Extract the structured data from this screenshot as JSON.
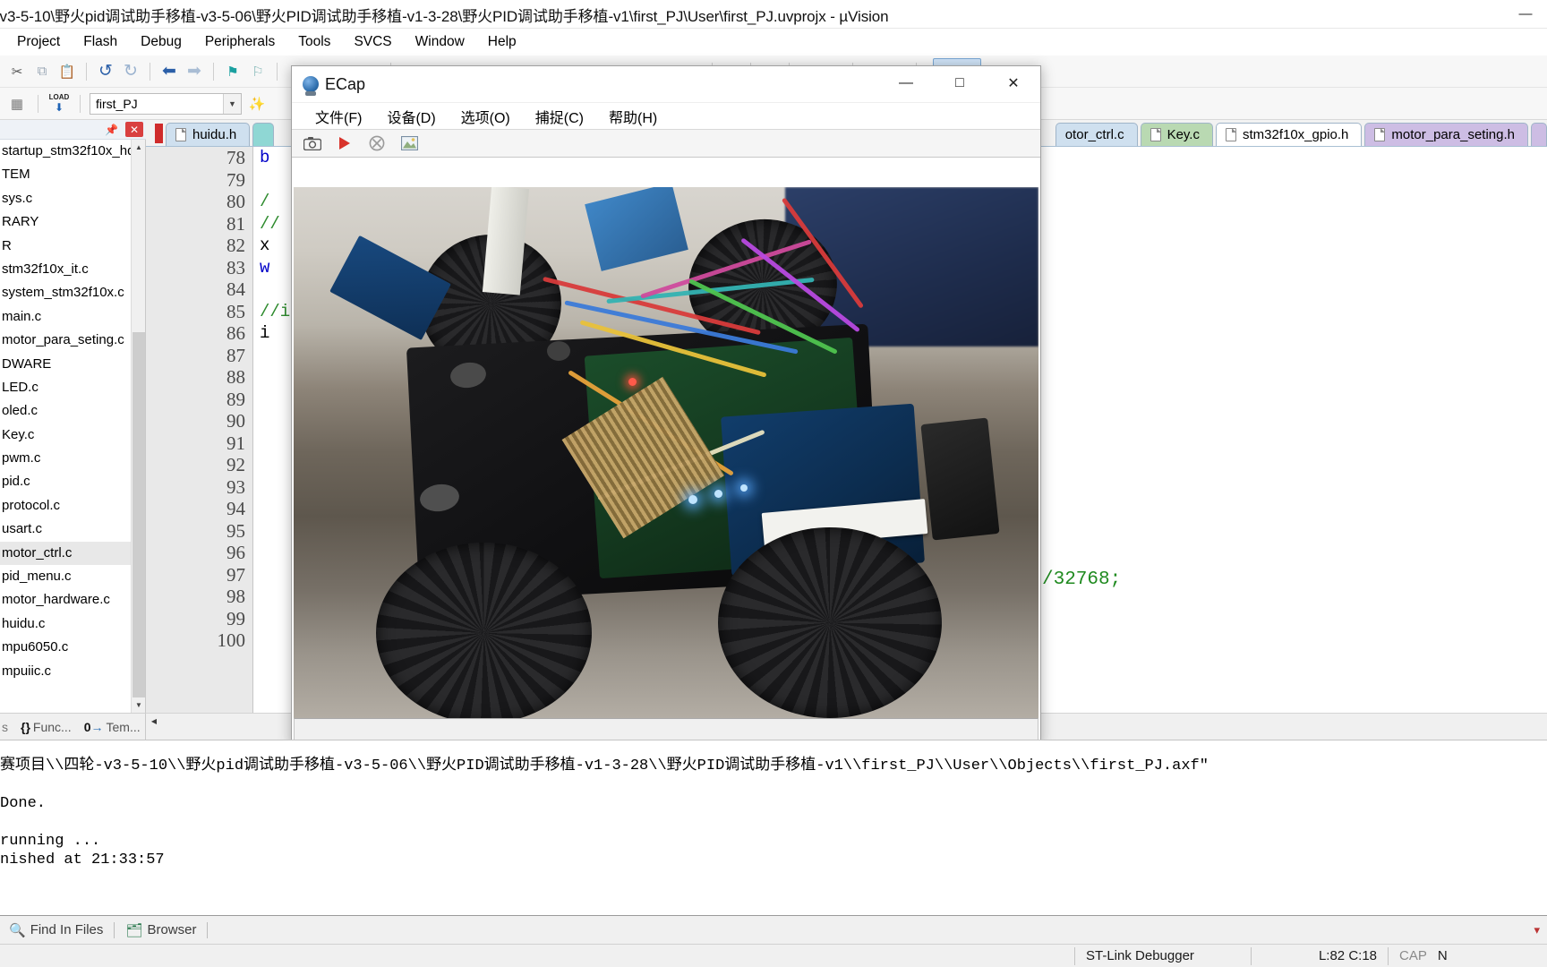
{
  "window": {
    "title": "-v3-5-10\\野火pid调试助手移植-v3-5-06\\野火PID调试助手移植-v1-3-28\\野火PID调试助手移植-v1\\first_PJ\\User\\first_PJ.uvprojx - µVision",
    "minimize": "—",
    "maximize": "▫",
    "close": "✕"
  },
  "menubar": {
    "items": [
      {
        "label": "Project"
      },
      {
        "label": "Flash"
      },
      {
        "label": "Debug"
      },
      {
        "label": "Peripherals"
      },
      {
        "label": "Tools"
      },
      {
        "label": "SVCS"
      },
      {
        "label": "Window"
      },
      {
        "label": "Help"
      }
    ]
  },
  "toolbar": {
    "row1_icons": [
      "cut-icon",
      "copy-icon",
      "paste-icon",
      "undo-icon",
      "redo-icon",
      "navigate-back-icon",
      "navigate-forward-icon",
      "bookmark-icon",
      "bookmark-next-icon"
    ],
    "row2": {
      "target_icon": "build-target-icon",
      "load_icon": "load-icon",
      "load_label": "LOAD",
      "project_value": "first_PJ",
      "dropdown_caret": "▼",
      "magic_wand_icon": "options-for-target-icon"
    }
  },
  "sidebar": {
    "pin_icon": "pin-icon",
    "close_icon": "✕",
    "items": [
      {
        "label": "startup_stm32f10x_hd",
        "selected": false
      },
      {
        "label": "TEM",
        "selected": false
      },
      {
        "label": "sys.c",
        "selected": false
      },
      {
        "label": "RARY",
        "selected": false
      },
      {
        "label": "R",
        "selected": false
      },
      {
        "label": "stm32f10x_it.c",
        "selected": false
      },
      {
        "label": "system_stm32f10x.c",
        "selected": false
      },
      {
        "label": "main.c",
        "selected": false
      },
      {
        "label": "motor_para_seting.c",
        "selected": false
      },
      {
        "label": "DWARE",
        "selected": false
      },
      {
        "label": "LED.c",
        "selected": false
      },
      {
        "label": "oled.c",
        "selected": false
      },
      {
        "label": "Key.c",
        "selected": false
      },
      {
        "label": "pwm.c",
        "selected": false
      },
      {
        "label": "pid.c",
        "selected": false
      },
      {
        "label": "protocol.c",
        "selected": false
      },
      {
        "label": "usart.c",
        "selected": false
      },
      {
        "label": "motor_ctrl.c",
        "selected": true
      },
      {
        "label": "pid_menu.c",
        "selected": false
      },
      {
        "label": "motor_hardware.c",
        "selected": false
      },
      {
        "label": "huidu.c",
        "selected": false
      },
      {
        "label": "mpu6050.c",
        "selected": false
      },
      {
        "label": "mpuiic.c",
        "selected": false
      }
    ],
    "footer": {
      "tabs": [
        "Func...",
        "Tem..."
      ],
      "func_icon": "{}",
      "tem_icon": "0→"
    }
  },
  "editor": {
    "tabs": [
      {
        "label": "huidu.h",
        "color": "#cfe0ef",
        "active": true
      },
      {
        "label": "otor_ctrl.c",
        "color": "#cfe0ef",
        "active": false
      },
      {
        "label": "Key.c",
        "color": "#b9d9b2",
        "active": false
      },
      {
        "label": "stm32f10x_gpio.h",
        "color": "#ffffff",
        "active": false
      },
      {
        "label": "motor_para_seting.h",
        "color": "#cdbde4",
        "active": false
      }
    ],
    "line_numbers": [
      78,
      79,
      80,
      81,
      82,
      83,
      84,
      85,
      86,
      87,
      88,
      89,
      90,
      91,
      92,
      93,
      94,
      95,
      96,
      97,
      98,
      99,
      100
    ],
    "visible_code_left": [
      "b",
      "",
      "/",
      "//",
      "x",
      "w",
      "",
      "//i",
      "i",
      "",
      "",
      "",
      "",
      "",
      "",
      "",
      "",
      "",
      "",
      "",
      "",
      "",
      ""
    ],
    "fragment_right": "/32768;"
  },
  "ecap": {
    "title": "ECap",
    "app_icon": "camera-icon",
    "minimize": "—",
    "maximize": "□",
    "close": "✕",
    "menu": [
      {
        "label": "文件(F)"
      },
      {
        "label": "设备(D)"
      },
      {
        "label": "选项(O)"
      },
      {
        "label": "捕捉(C)"
      },
      {
        "label": "帮助(H)"
      }
    ],
    "toolbar": [
      {
        "name": "snapshot-icon",
        "glyph": "📷"
      },
      {
        "name": "play-icon",
        "glyph": "▶"
      },
      {
        "name": "stop-icon",
        "glyph": "⊗"
      },
      {
        "name": "image-icon",
        "glyph": "🖼"
      }
    ],
    "preview_alt": "live camera preview of a black four-wheel robot car chassis with arduino/stm32 boards and colored jumper wires on a desk"
  },
  "build_output": {
    "lines": [
      "赛项目\\\\四轮-v3-5-10\\\\野火pid调试助手移植-v3-5-06\\\\野火PID调试助手移植-v1-3-28\\\\野火PID调试助手移植-v1\\\\first_PJ\\\\User\\\\Objects\\\\first_PJ.axf\"",
      "",
      "Done.",
      "",
      "running ...",
      "nished at 21:33:57"
    ]
  },
  "bottom_tabs": [
    {
      "label": "Find In Files",
      "icon": "find-in-files-icon"
    },
    {
      "label": "Browser",
      "icon": "browser-icon"
    }
  ],
  "statusbar": {
    "debugger": "ST-Link Debugger",
    "position": "L:82 C:18",
    "cap": "CAP",
    "num": "N"
  },
  "colors": {
    "accent": "#2f6fae",
    "selection": "#e8e8e8",
    "comment_green": "#2e8b2e",
    "close_red": "#cf2b2b"
  }
}
